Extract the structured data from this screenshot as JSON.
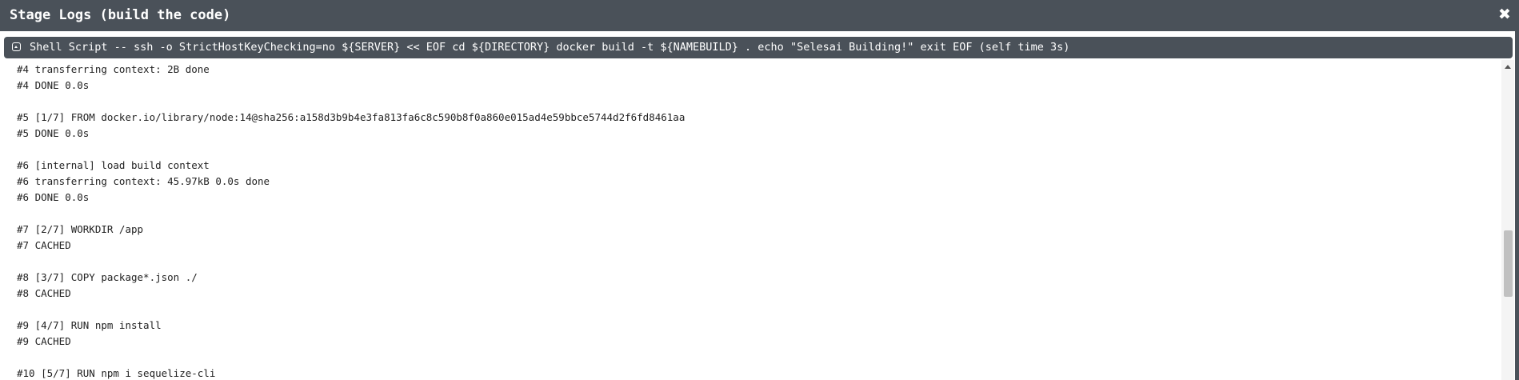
{
  "window": {
    "title": "Stage Logs (build the code)",
    "close_icon": "✖"
  },
  "step": {
    "icon": "collapse-icon",
    "text": "Shell Script -- ssh -o StrictHostKeyChecking=no ${SERVER} << EOF cd ${DIRECTORY} docker build -t ${NAMEBUILD} . echo \"Selesai Building!\" exit EOF (self time 3s)"
  },
  "log": {
    "lines": [
      "#4 transferring context: 2B done",
      "#4 DONE 0.0s",
      "",
      "#5 [1/7] FROM docker.io/library/node:14@sha256:a158d3b9b4e3fa813fa6c8c590b8f0a860e015ad4e59bbce5744d2f6fd8461aa",
      "#5 DONE 0.0s",
      "",
      "#6 [internal] load build context",
      "#6 transferring context: 45.97kB 0.0s done",
      "#6 DONE 0.0s",
      "",
      "#7 [2/7] WORKDIR /app",
      "#7 CACHED",
      "",
      "#8 [3/7] COPY package*.json ./",
      "#8 CACHED",
      "",
      "#9 [4/7] RUN npm install",
      "#9 CACHED",
      "",
      "#10 [5/7] RUN npm i sequelize-cli"
    ]
  },
  "colors": {
    "header_bg": "#4a5159",
    "header_text": "#ffffff",
    "log_text": "#222222",
    "scrollbar_thumb": "#c1c1c1"
  }
}
